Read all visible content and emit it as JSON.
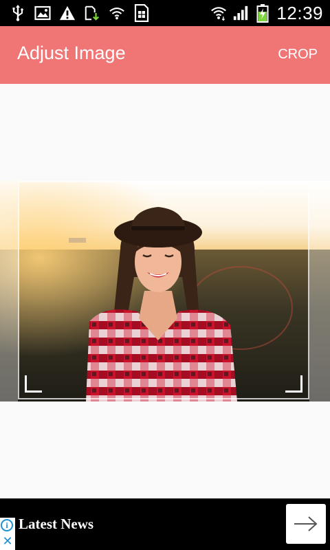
{
  "status_bar": {
    "time": "12:39",
    "icons_left": [
      "usb-icon",
      "image-icon",
      "warning-icon",
      "download-icon",
      "wifi-icon",
      "sim-icon"
    ],
    "icons_right": [
      "wifi-signal-icon",
      "cell-signal-icon",
      "battery-charging-icon"
    ]
  },
  "app_bar": {
    "title": "Adjust Image",
    "crop_label": "CROP",
    "color": "#f07676"
  },
  "ad": {
    "headline": "Latest News",
    "info_glyph": "i",
    "close_glyph": "✕",
    "accent": "#1e8fd1"
  }
}
